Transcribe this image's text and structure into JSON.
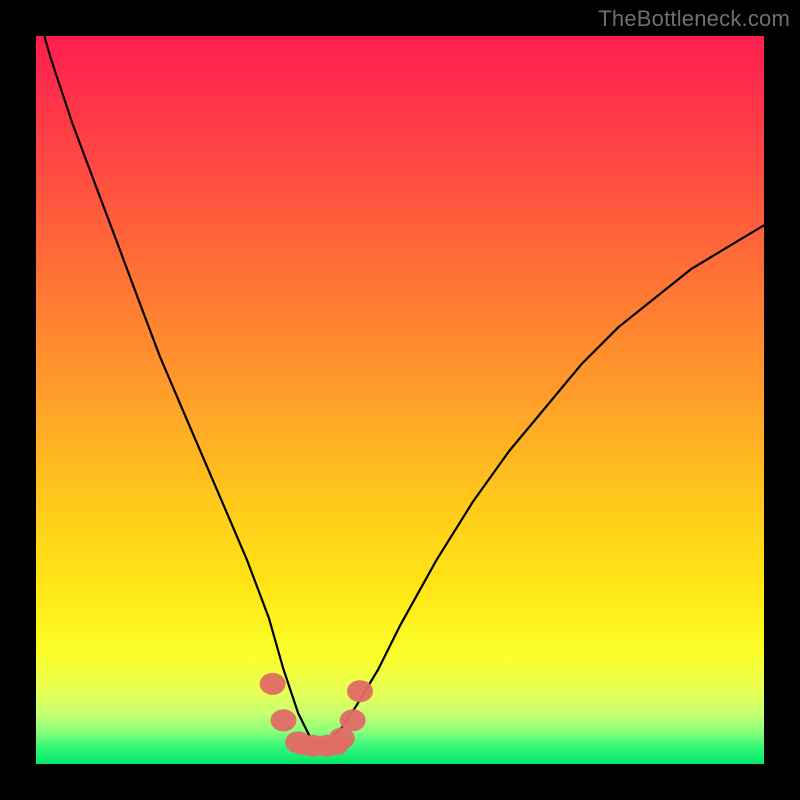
{
  "watermark": "TheBottleneck.com",
  "chart_data": {
    "type": "line",
    "title": "",
    "xlabel": "",
    "ylabel": "",
    "xlim": [
      0,
      100
    ],
    "ylim": [
      0,
      100
    ],
    "grid": false,
    "series": [
      {
        "name": "bottleneck-curve",
        "note": "V-shaped curve with minimum near x≈38; y is bottleneck percentage (estimated by vertical position).",
        "x": [
          0,
          2,
          5,
          8,
          11,
          14,
          17,
          20,
          23,
          26,
          29,
          32,
          34,
          36,
          38,
          40,
          42,
          44,
          47,
          50,
          55,
          60,
          65,
          70,
          75,
          80,
          85,
          90,
          95,
          100
        ],
        "y": [
          104,
          97,
          88,
          80,
          72,
          64,
          56,
          49,
          42,
          35,
          28,
          20,
          13,
          7,
          3,
          3,
          5,
          8,
          13,
          19,
          28,
          36,
          43,
          49,
          55,
          60,
          64,
          68,
          71,
          74
        ]
      },
      {
        "name": "highlight-points",
        "note": "Salmon blob markers near the valley of the curve",
        "x": [
          32.5,
          34,
          36,
          38,
          40,
          42,
          43.5,
          44.5
        ],
        "y": [
          11,
          6,
          3,
          2.5,
          2.5,
          3.5,
          6,
          10
        ]
      }
    ],
    "background_gradient": {
      "top_color": "#ff1e4f",
      "mid_color": "#ffd400",
      "bottom_accent": "#00e86b"
    }
  }
}
